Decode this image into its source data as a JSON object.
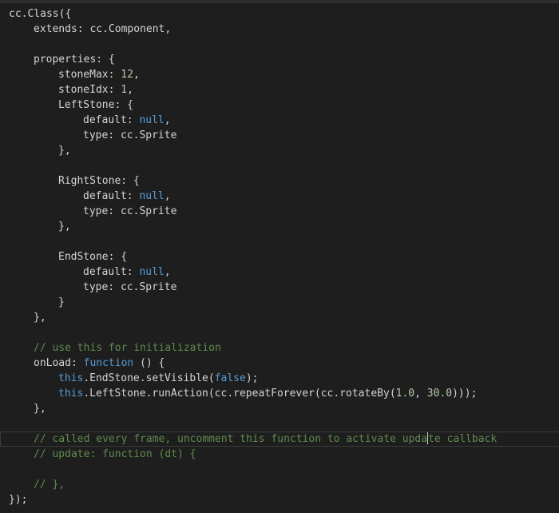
{
  "editor": {
    "lines": [
      {
        "indent": 0,
        "tokens": [
          {
            "t": "txt",
            "v": "cc.Class({"
          }
        ]
      },
      {
        "indent": 1,
        "tokens": [
          {
            "t": "txt",
            "v": "extends: cc.Component,"
          }
        ]
      },
      {
        "indent": 0,
        "tokens": []
      },
      {
        "indent": 1,
        "tokens": [
          {
            "t": "txt",
            "v": "properties: {"
          }
        ]
      },
      {
        "indent": 2,
        "tokens": [
          {
            "t": "txt",
            "v": "stoneMax: "
          },
          {
            "t": "num",
            "v": "12"
          },
          {
            "t": "txt",
            "v": ","
          }
        ]
      },
      {
        "indent": 2,
        "tokens": [
          {
            "t": "txt",
            "v": "stoneIdx: "
          },
          {
            "t": "num",
            "v": "1"
          },
          {
            "t": "txt",
            "v": ","
          }
        ]
      },
      {
        "indent": 2,
        "tokens": [
          {
            "t": "txt",
            "v": "LeftStone: {"
          }
        ]
      },
      {
        "indent": 3,
        "tokens": [
          {
            "t": "txt",
            "v": "default: "
          },
          {
            "t": "kw",
            "v": "null"
          },
          {
            "t": "txt",
            "v": ","
          }
        ]
      },
      {
        "indent": 3,
        "tokens": [
          {
            "t": "txt",
            "v": "type: cc.Sprite"
          }
        ]
      },
      {
        "indent": 2,
        "tokens": [
          {
            "t": "txt",
            "v": "},"
          }
        ]
      },
      {
        "indent": 0,
        "tokens": []
      },
      {
        "indent": 2,
        "tokens": [
          {
            "t": "txt",
            "v": "RightStone: {"
          }
        ]
      },
      {
        "indent": 3,
        "tokens": [
          {
            "t": "txt",
            "v": "default: "
          },
          {
            "t": "kw",
            "v": "null"
          },
          {
            "t": "txt",
            "v": ","
          }
        ]
      },
      {
        "indent": 3,
        "tokens": [
          {
            "t": "txt",
            "v": "type: cc.Sprite"
          }
        ]
      },
      {
        "indent": 2,
        "tokens": [
          {
            "t": "txt",
            "v": "},"
          }
        ]
      },
      {
        "indent": 0,
        "tokens": []
      },
      {
        "indent": 2,
        "tokens": [
          {
            "t": "txt",
            "v": "EndStone: {"
          }
        ]
      },
      {
        "indent": 3,
        "tokens": [
          {
            "t": "txt",
            "v": "default: "
          },
          {
            "t": "kw",
            "v": "null"
          },
          {
            "t": "txt",
            "v": ","
          }
        ]
      },
      {
        "indent": 3,
        "tokens": [
          {
            "t": "txt",
            "v": "type: cc.Sprite"
          }
        ]
      },
      {
        "indent": 2,
        "tokens": [
          {
            "t": "txt",
            "v": "}"
          }
        ]
      },
      {
        "indent": 1,
        "tokens": [
          {
            "t": "txt",
            "v": "},"
          }
        ]
      },
      {
        "indent": 0,
        "tokens": []
      },
      {
        "indent": 1,
        "tokens": [
          {
            "t": "cm",
            "v": "// use this for initialization"
          }
        ]
      },
      {
        "indent": 1,
        "tokens": [
          {
            "t": "txt",
            "v": "onLoad: "
          },
          {
            "t": "kw",
            "v": "function"
          },
          {
            "t": "txt",
            "v": " () {"
          }
        ]
      },
      {
        "indent": 2,
        "tokens": [
          {
            "t": "kw",
            "v": "this"
          },
          {
            "t": "txt",
            "v": ".EndStone.setVisible("
          },
          {
            "t": "kw",
            "v": "false"
          },
          {
            "t": "txt",
            "v": ");"
          }
        ]
      },
      {
        "indent": 2,
        "tokens": [
          {
            "t": "kw",
            "v": "this"
          },
          {
            "t": "txt",
            "v": ".LeftStone.runAction(cc.repeatForever(cc.rotateBy("
          },
          {
            "t": "num",
            "v": "1.0"
          },
          {
            "t": "txt",
            "v": ", "
          },
          {
            "t": "num",
            "v": "30.0"
          },
          {
            "t": "txt",
            "v": ")));"
          }
        ]
      },
      {
        "indent": 1,
        "tokens": [
          {
            "t": "txt",
            "v": "},"
          }
        ]
      },
      {
        "indent": 0,
        "tokens": []
      },
      {
        "indent": 1,
        "current": true,
        "tokens": [
          {
            "t": "cm",
            "v": "// called every frame, uncomment this function to activate upda"
          },
          {
            "t": "caret",
            "v": ""
          },
          {
            "t": "cm",
            "v": "te callback"
          }
        ]
      },
      {
        "indent": 1,
        "tokens": [
          {
            "t": "cm",
            "v": "// update: function (dt) {"
          }
        ]
      },
      {
        "indent": 0,
        "tokens": []
      },
      {
        "indent": 1,
        "tokens": [
          {
            "t": "cm",
            "v": "// },"
          }
        ]
      },
      {
        "indent": 0,
        "tokens": [
          {
            "t": "txt",
            "v": "});"
          }
        ]
      }
    ]
  }
}
